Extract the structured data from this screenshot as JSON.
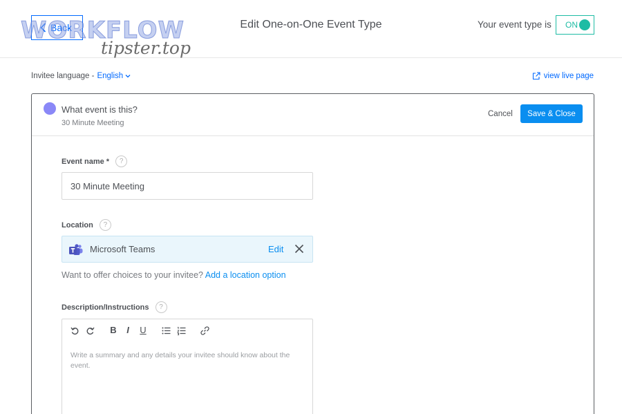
{
  "topbar": {
    "back_label": "Back",
    "logo_top": "WORKFLOW",
    "logo_bottom": "tipster.top",
    "title": "Edit One-on-One Event Type",
    "status_label": "Your event type is",
    "toggle_label": "ON",
    "toggle_on": true
  },
  "subbar": {
    "language_label": "Invitee language -",
    "language_value": "English",
    "live_link": "view live page"
  },
  "panel": {
    "title": "What event is this?",
    "subtitle": "30 Minute Meeting",
    "event_color": "#8a88f7",
    "cancel_label": "Cancel",
    "save_label": "Save & Close",
    "help_glyph": "?",
    "event_name": {
      "label": "Event name *",
      "value": "30 Minute Meeting"
    },
    "location": {
      "label": "Location",
      "name": "Microsoft Teams",
      "icon": "microsoft-teams-icon",
      "edit_label": "Edit",
      "hint": "Want to offer choices to your invitee?",
      "add_link": "Add a location option"
    },
    "description": {
      "label": "Description/Instructions",
      "placeholder": "Write a summary and any details your invitee should know about the event.",
      "toolbar": [
        "undo-icon",
        "redo-icon",
        "bold-icon",
        "italic-icon",
        "underline-icon",
        "bullet-list-icon",
        "numbered-list-icon",
        "link-icon"
      ],
      "bold_glyph": "B",
      "italic_glyph": "I",
      "underline_glyph": "U"
    }
  },
  "colors": {
    "accent": "#0069ff",
    "toggle": "#1ebca4",
    "save_button": "#0a8ef0",
    "location_bg": "#eaf6fc"
  }
}
